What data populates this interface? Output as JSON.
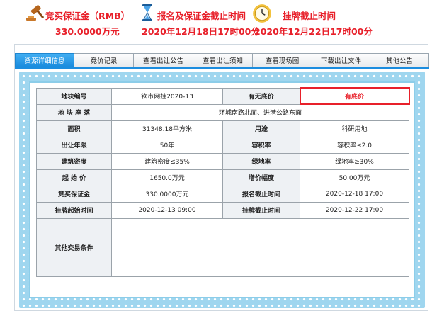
{
  "header": {
    "deposit": {
      "title": "竞买保证金（RMB）",
      "value": "330.0000万元",
      "icon": "gavel-icon"
    },
    "register_deadline": {
      "title": "报名及保证金截止时间",
      "value": "2020年12月18日17时00分",
      "icon": "hourglass-icon"
    },
    "listing_deadline": {
      "title": "挂牌截止时间",
      "value": "2020年12月22日17时00分",
      "icon": "clock-icon"
    }
  },
  "tabs": [
    {
      "label": "资源详细信息",
      "active": true
    },
    {
      "label": "竞价记录",
      "active": false
    },
    {
      "label": "查看出让公告",
      "active": false
    },
    {
      "label": "查看出让须知",
      "active": false
    },
    {
      "label": "查看现场图",
      "active": false
    },
    {
      "label": "下载出让文件",
      "active": false
    },
    {
      "label": "其他公告",
      "active": false
    }
  ],
  "details": {
    "parcel_no_label": "地块编号",
    "parcel_no": "钦市网挂2020-13",
    "reserve_label": "有无底价",
    "reserve": "有底价",
    "location_label": "地 块 座 落",
    "location": "环城南路北面、进港公路东面",
    "area_label": "面积",
    "area": "31348.18平方米",
    "use_label": "用途",
    "use": "科研用地",
    "term_label": "出让年限",
    "term": "50年",
    "far_label": "容积率",
    "far": "容积率≤2.0",
    "density_label": "建筑密度",
    "density": "建筑密度≤35%",
    "green_label": "绿地率",
    "green": "绿地率≥30%",
    "start_price_label": "起 始 价",
    "start_price": "1650.0万元",
    "increment_label": "增价幅度",
    "increment": "50.00万元",
    "deposit_label": "竞买保证金",
    "deposit": "330.0000万元",
    "reg_deadline_label": "报名截止时间",
    "reg_deadline": "2020-12-18 17:00",
    "listing_start_label": "挂牌起始时间",
    "listing_start": "2020-12-13 09:00",
    "listing_end_label": "挂牌截止时间",
    "listing_end": "2020-12-22 17:00",
    "other_terms_label": "其他交易条件",
    "other_terms": ""
  },
  "colors": {
    "accent_red": "#e8202a",
    "tab_active": "#1b8ddf",
    "frame": "#9fd6ef"
  }
}
